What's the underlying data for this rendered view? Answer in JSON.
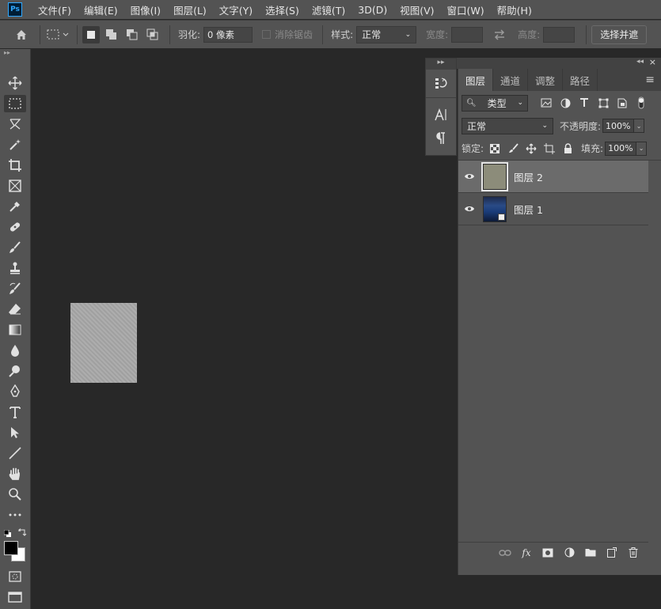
{
  "app": {
    "logo": "Ps"
  },
  "menu": [
    {
      "label": "文件(F)"
    },
    {
      "label": "编辑(E)"
    },
    {
      "label": "图像(I)"
    },
    {
      "label": "图层(L)"
    },
    {
      "label": "文字(Y)"
    },
    {
      "label": "选择(S)"
    },
    {
      "label": "滤镜(T)"
    },
    {
      "label": "3D(D)"
    },
    {
      "label": "视图(V)"
    },
    {
      "label": "窗口(W)"
    },
    {
      "label": "帮助(H)"
    }
  ],
  "options": {
    "feather_label": "羽化:",
    "feather_value": "0 像素",
    "antialias_label": "消除锯齿",
    "style_label": "样式:",
    "style_value": "正常",
    "width_label": "宽度:",
    "height_label": "高度:",
    "select_mask_button": "选择并遮"
  },
  "layers_panel": {
    "tabs": [
      {
        "label": "图层",
        "active": true
      },
      {
        "label": "通道"
      },
      {
        "label": "调整"
      },
      {
        "label": "路径"
      }
    ],
    "filter_kind": "类型",
    "blend_mode": "正常",
    "opacity_label": "不透明度:",
    "opacity_value": "100%",
    "lock_label": "锁定:",
    "fill_label": "填充:",
    "fill_value": "100%",
    "layers": [
      {
        "name": "图层 2",
        "visible": true,
        "selected": true
      },
      {
        "name": "图层 1",
        "visible": true,
        "selected": false
      }
    ],
    "footer_fx": "fx"
  },
  "colors": {
    "foreground": "#000000",
    "background": "#ffffff",
    "canvas_bg": "#282828",
    "panel_bg": "#535353"
  }
}
